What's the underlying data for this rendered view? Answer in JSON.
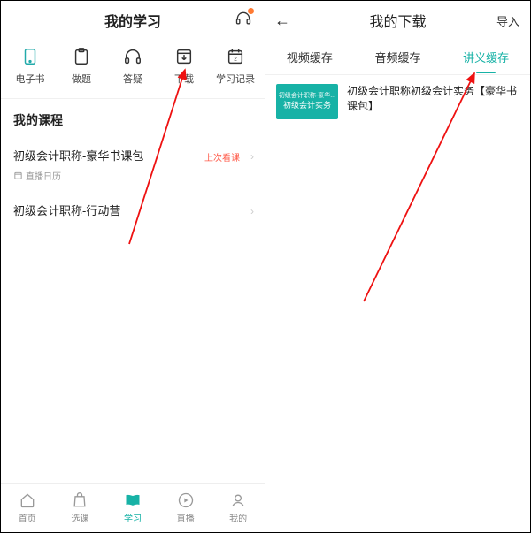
{
  "colors": {
    "accent": "#17b2a6",
    "danger": "#ff5b4a",
    "badge": "#ff7a33"
  },
  "left": {
    "title": "我的学习",
    "tools": [
      {
        "id": "ebook",
        "label": "电子书"
      },
      {
        "id": "practice",
        "label": "做题"
      },
      {
        "id": "qa",
        "label": "答疑"
      },
      {
        "id": "download",
        "label": "下载"
      },
      {
        "id": "record",
        "label": "学习记录"
      }
    ],
    "section_title": "我的课程",
    "courses": [
      {
        "title": "初级会计职称-豪华书课包",
        "sub": "直播日历",
        "last_tag": "上次看课"
      },
      {
        "title": "初级会计职称-行动营"
      }
    ],
    "nav": [
      {
        "id": "home",
        "label": "首页"
      },
      {
        "id": "select",
        "label": "选课"
      },
      {
        "id": "study",
        "label": "学习",
        "active": true
      },
      {
        "id": "live",
        "label": "直播"
      },
      {
        "id": "mine",
        "label": "我的"
      }
    ]
  },
  "right": {
    "title": "我的下载",
    "import_label": "导入",
    "tabs": [
      {
        "id": "video",
        "label": "视频缓存"
      },
      {
        "id": "audio",
        "label": "音频缓存"
      },
      {
        "id": "notes",
        "label": "讲义缓存",
        "active": true
      }
    ],
    "items": [
      {
        "thumb_top": "初级会计职称-豪华...",
        "thumb_main": "初级会计实务",
        "title": "初级会计职称初级会计实务【豪华书课包】"
      }
    ]
  }
}
